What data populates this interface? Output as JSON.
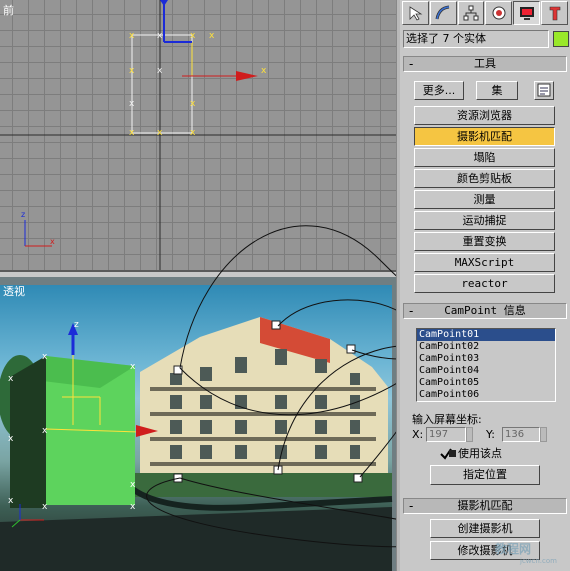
{
  "viewports": {
    "front_label": "前",
    "persp_label": "透视"
  },
  "panel": {
    "tabs": [
      {
        "name": "create-tab-icon"
      },
      {
        "name": "modify-tab-icon"
      },
      {
        "name": "hierarchy-tab-icon"
      },
      {
        "name": "motion-tab-icon"
      },
      {
        "name": "display-tab-icon"
      },
      {
        "name": "utilities-tab-icon"
      }
    ],
    "selection_text": "选择了 7 个实体",
    "selection_color": "#99e82a",
    "tools": {
      "header": "工具",
      "more_label": "更多...",
      "set_label": "集",
      "buttons": [
        "资源浏览器",
        "摄影机匹配",
        "塌陷",
        "颜色剪贴板",
        "测量",
        "运动捕捉",
        "重置变换",
        "MAXScript",
        "reactor"
      ],
      "active_button": "摄影机匹配"
    },
    "campoint": {
      "header": "CamPoint 信息",
      "items": [
        "CamPoint01",
        "CamPoint02",
        "CamPoint03",
        "CamPoint04",
        "CamPoint05",
        "CamPoint06"
      ],
      "selected": "CamPoint01",
      "input_label": "输入屏幕坐标:",
      "x_label": "X:",
      "x_value": "197",
      "y_label": "Y:",
      "y_value": "136",
      "use_point_label": "使用该点",
      "assign_label": "指定位置"
    },
    "camera_match": {
      "header": "摄影机匹配",
      "create_label": "创建摄影机",
      "modify_label": "修改摄影机"
    }
  },
  "watermark": {
    "text": "教程网",
    "url": "jcwcn.com"
  },
  "colors": {
    "active_button": "#f5c542",
    "list_selection": "#2b4e8c",
    "box_green": "#5dd35d"
  }
}
